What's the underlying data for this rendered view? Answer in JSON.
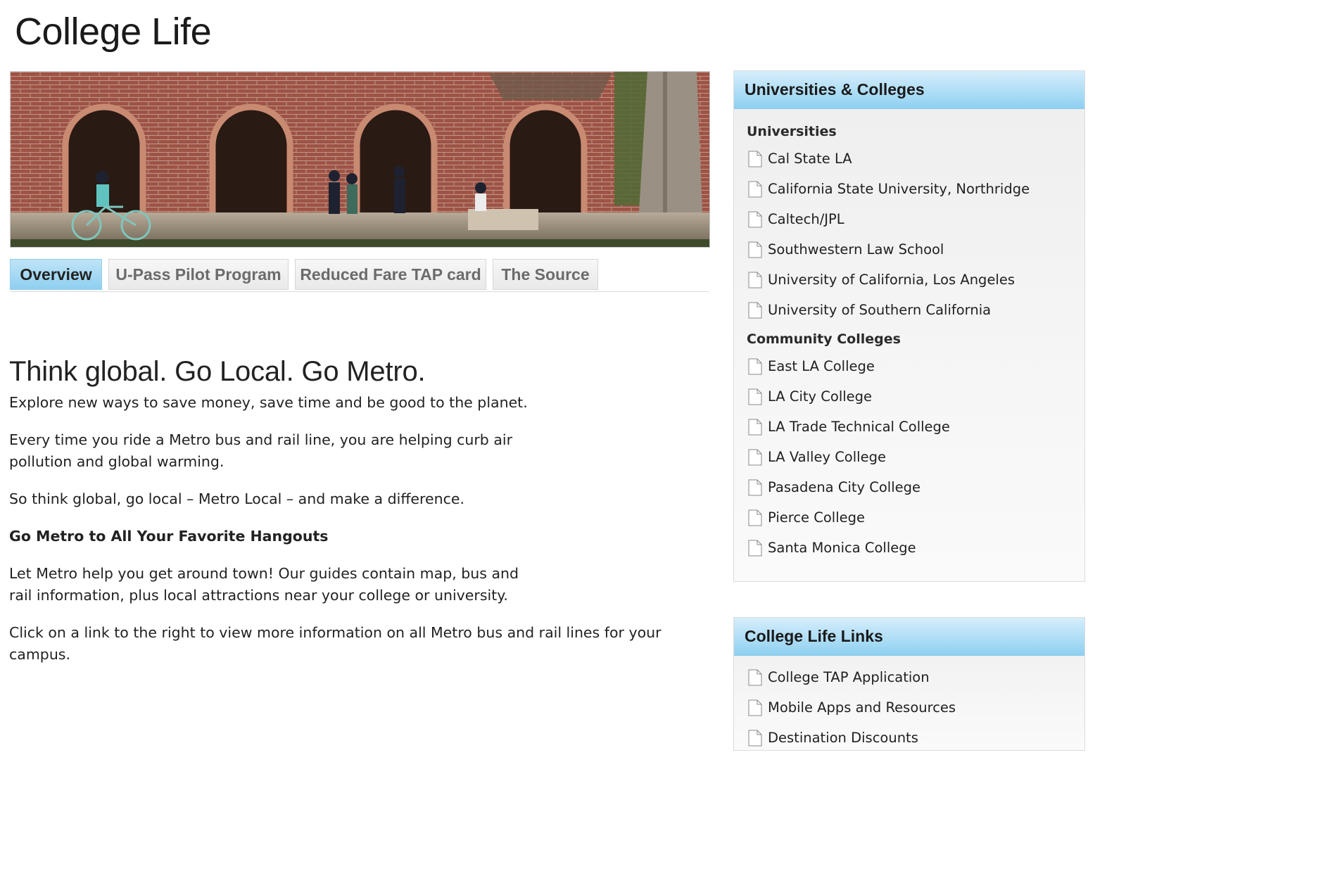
{
  "page": {
    "title": "College Life"
  },
  "hero": {
    "alt": "Students walking and biking past brick arches on campus"
  },
  "tabs": [
    {
      "label": "Overview",
      "active": true
    },
    {
      "label": "U-Pass Pilot Program",
      "active": false
    },
    {
      "label": "Reduced Fare TAP card",
      "active": false
    },
    {
      "label": "The Source",
      "active": false
    }
  ],
  "main": {
    "headline": "Think global. Go Local. Go Metro.",
    "p1": "Explore new ways to save money, save time and be good to the planet.",
    "p2": "Every time you ride a Metro bus and rail line, you are helping curb air pollution and global warming.",
    "p3": "So think global, go local – Metro Local – and make a difference.",
    "subheading": "Go Metro to All Your Favorite Hangouts",
    "p4": "Let Metro help you get around town! Our guides contain map, bus and rail information, plus local attractions near your college or university.",
    "p5": "Click on a link to the right to view more information on all Metro bus and rail lines for your campus."
  },
  "sidebar": {
    "universities_panel": {
      "title": "Universities & Colleges",
      "sections": [
        {
          "title": "Universities",
          "items": [
            "Cal State LA",
            "California State University, Northridge",
            "Caltech/JPL",
            "Southwestern Law School",
            "University of California, Los Angeles",
            "University of Southern California"
          ]
        },
        {
          "title": "Community Colleges",
          "items": [
            "East LA College",
            "LA City College",
            "LA Trade Technical College",
            "LA Valley College",
            "Pasadena City College",
            "Pierce College",
            "Santa Monica College"
          ]
        }
      ]
    },
    "links_panel": {
      "title": "College Life Links",
      "items": [
        "College TAP Application",
        "Mobile Apps and Resources",
        "Destination Discounts"
      ]
    }
  },
  "colors": {
    "accent": "#8fd0f1",
    "tab_active": "#a8dbf4",
    "brick": "#a8594a"
  },
  "icons": {
    "link_item": "document-icon"
  }
}
